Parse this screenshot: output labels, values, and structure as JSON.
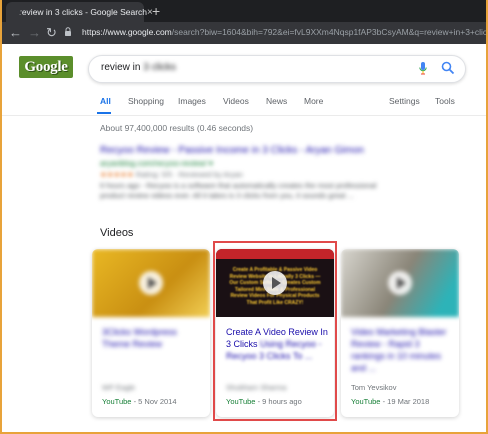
{
  "browser": {
    "tab_title": "review in 3 clicks - Google Search",
    "tab_close": "×",
    "new_tab": "+",
    "url_host": "https://www.google.com",
    "url_rest": "/search?biw=1604&bih=792&ei=fvL9XXm4Nqsp1fAP3bCsyAM&q=review+in+3+clicks"
  },
  "search": {
    "logo": "Google",
    "query_visible": "review in",
    "query_blurred": "3 clicks"
  },
  "nav": {
    "items": [
      "All",
      "Shopping",
      "Images",
      "Videos",
      "News",
      "More"
    ],
    "settings": "Settings",
    "tools": "Tools"
  },
  "stats": "About 97,400,000 results (0.46 seconds)",
  "first_result": {
    "title": "Recyoo Review - Passive Income in 3 Clicks - Aryan Gimon",
    "url": "aryanblog.com/recyoo-review/ ▾",
    "stars": "★★★★★",
    "rating_text": "Rating: 5/5 · Reviewed by Aryan",
    "snippet": "6 hours ago - Recyoo is a software that automatically creates the most professional product review videos ever. All it takes is 3 clicks from you, it sounds great ..."
  },
  "videos": {
    "heading": "Videos",
    "cards": [
      {
        "title": "3Clicks Wordpress Theme Review",
        "channel": "WP Eagle",
        "source": "YouTube",
        "date": "5 Nov 2014"
      },
      {
        "title_visible": "Create A Video Review In 3 Clicks",
        "title_blurred": "Using Recyoo - Recyoo 3 Clicks To ...",
        "channel": "Shubham Sharma",
        "source": "YouTube",
        "date": "9 hours ago",
        "thumb_text": "Create A Profitable & Passive Video Review Website in Literally 3 Clicks — Our Custom Software Creates Custom Tailored Mini Sites & Professional Review Videos For Physical Products That Profit Like CRAZY!"
      },
      {
        "title": "Video Marketing Blaster Review - Rapid 3 rankings in 10 minutes and ...",
        "channel": "Tom Yevsikov",
        "source": "YouTube",
        "date": "19 Mar 2018"
      }
    ]
  },
  "colors": {
    "link": "#1a0dab",
    "active_tab": "#1a73e8",
    "url_green": "#188038",
    "highlight_border": "#e04a4a",
    "frame": "#e8a33a"
  }
}
